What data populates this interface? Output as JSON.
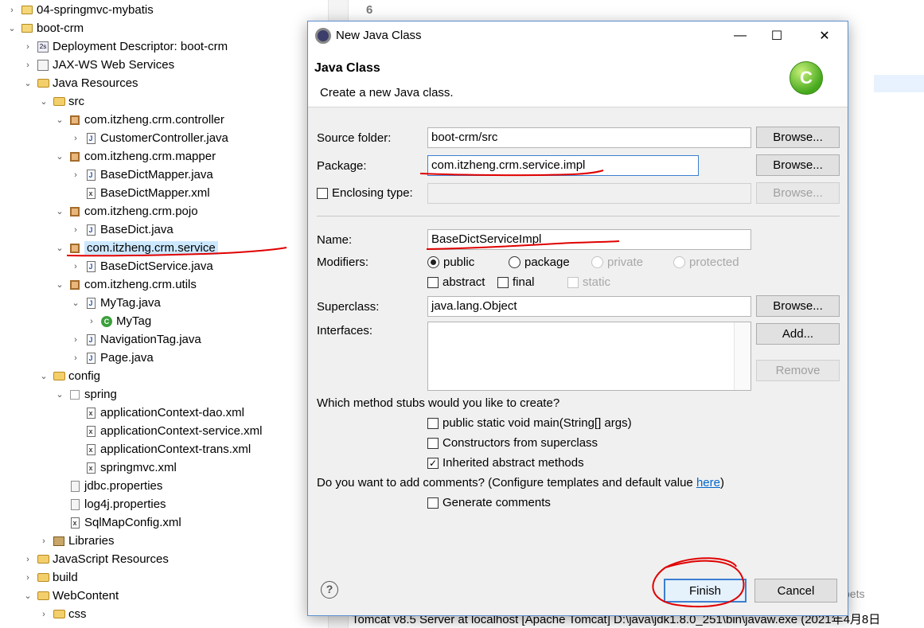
{
  "explorer": {
    "items": [
      {
        "label": "04-springmvc-mybatis",
        "icon": "project-icon",
        "arrow": "›"
      },
      {
        "label": "boot-crm",
        "icon": "project-icon",
        "arrow": "⌄"
      },
      {
        "label": "Deployment Descriptor: boot-crm",
        "icon": "deployment-descriptor-icon",
        "arrow": "›"
      },
      {
        "label": "JAX-WS Web Services",
        "icon": "web-services-icon",
        "arrow": "›"
      },
      {
        "label": "Java Resources",
        "icon": "java-resources-icon",
        "arrow": "⌄"
      },
      {
        "label": "src",
        "icon": "source-folder-icon",
        "arrow": "⌄"
      },
      {
        "label": "com.itzheng.crm.controller",
        "icon": "package-icon",
        "arrow": "⌄"
      },
      {
        "label": "CustomerController.java",
        "icon": "java-file-icon",
        "arrow": "›"
      },
      {
        "label": "com.itzheng.crm.mapper",
        "icon": "package-icon",
        "arrow": "⌄"
      },
      {
        "label": "BaseDictMapper.java",
        "icon": "java-file-icon",
        "arrow": "›"
      },
      {
        "label": "BaseDictMapper.xml",
        "icon": "xml-file-icon",
        "arrow": ""
      },
      {
        "label": "com.itzheng.crm.pojo",
        "icon": "package-icon",
        "arrow": "⌄"
      },
      {
        "label": "BaseDict.java",
        "icon": "java-file-icon",
        "arrow": "›"
      },
      {
        "label": "com.itzheng.crm.service",
        "icon": "package-icon",
        "arrow": "⌄"
      },
      {
        "label": "BaseDictService.java",
        "icon": "java-file-icon",
        "arrow": "›"
      },
      {
        "label": "com.itzheng.crm.utils",
        "icon": "package-icon",
        "arrow": "⌄"
      },
      {
        "label": "MyTag.java",
        "icon": "java-file-icon",
        "arrow": "⌄"
      },
      {
        "label": "MyTag",
        "icon": "class-icon",
        "arrow": "›"
      },
      {
        "label": "NavigationTag.java",
        "icon": "java-file-icon",
        "arrow": "›"
      },
      {
        "label": "Page.java",
        "icon": "java-file-icon",
        "arrow": "›"
      },
      {
        "label": "config",
        "icon": "source-folder-icon",
        "arrow": "⌄"
      },
      {
        "label": "spring",
        "icon": "empty-package-icon",
        "arrow": "⌄"
      },
      {
        "label": "applicationContext-dao.xml",
        "icon": "xml-file-icon",
        "arrow": ""
      },
      {
        "label": "applicationContext-service.xml",
        "icon": "xml-file-icon",
        "arrow": ""
      },
      {
        "label": "applicationContext-trans.xml",
        "icon": "xml-file-icon",
        "arrow": ""
      },
      {
        "label": "springmvc.xml",
        "icon": "xml-file-icon",
        "arrow": ""
      },
      {
        "label": "jdbc.properties",
        "icon": "properties-file-icon",
        "arrow": ""
      },
      {
        "label": "log4j.properties",
        "icon": "properties-file-icon",
        "arrow": ""
      },
      {
        "label": "SqlMapConfig.xml",
        "icon": "xml-file-icon",
        "arrow": ""
      },
      {
        "label": "Libraries",
        "icon": "libraries-icon",
        "arrow": "›"
      },
      {
        "label": "JavaScript Resources",
        "icon": "javascript-resources-icon",
        "arrow": "›"
      },
      {
        "label": "build",
        "icon": "folder-icon",
        "arrow": "›"
      },
      {
        "label": "WebContent",
        "icon": "folder-icon",
        "arrow": "⌄"
      },
      {
        "label": "css",
        "icon": "folder-icon",
        "arrow": "›"
      }
    ]
  },
  "editor": {
    "line_number": "6",
    "console_tab": "pets",
    "console_line": "Tomcat v8.5 Server at localhost [Apache Tomcat] D:\\java\\jdk1.8.0_251\\bin\\javaw.exe (2021年4月8日"
  },
  "dialog": {
    "window_title": "New Java Class",
    "header_title": "Java Class",
    "header_message": "Create a new Java class.",
    "source_folder": {
      "label": "Source folder:",
      "value": "boot-crm/src",
      "browse": "Browse..."
    },
    "package": {
      "label": "Package:",
      "value": "com.itzheng.crm.service.impl",
      "browse": "Browse..."
    },
    "enclosing_type": {
      "label": "Enclosing type:",
      "value": "",
      "browse": "Browse...",
      "checked": false
    },
    "name": {
      "label": "Name:",
      "value": "BaseDictServiceImpl"
    },
    "modifiers": {
      "label": "Modifiers:",
      "public": "public",
      "package": "package",
      "private": "private",
      "protected": "protected",
      "abstract": "abstract",
      "final": "final",
      "static": "static",
      "selected": "public"
    },
    "superclass": {
      "label": "Superclass:",
      "value": "java.lang.Object",
      "browse": "Browse..."
    },
    "interfaces": {
      "label": "Interfaces:",
      "add": "Add...",
      "remove": "Remove"
    },
    "stubs": {
      "question": "Which method stubs would you like to create?",
      "main": "public static void main(String[] args)",
      "constructors": "Constructors from superclass",
      "inherited": "Inherited abstract methods",
      "main_checked": false,
      "constructors_checked": false,
      "inherited_checked": true
    },
    "comments": {
      "question_prefix": "Do you want to add comments? (Configure templates and default value ",
      "link": "here",
      "question_suffix": ")",
      "generate": "Generate comments",
      "generate_checked": false
    },
    "help": "?",
    "finish": "Finish",
    "cancel": "Cancel",
    "annotation_color": "#e00000"
  }
}
